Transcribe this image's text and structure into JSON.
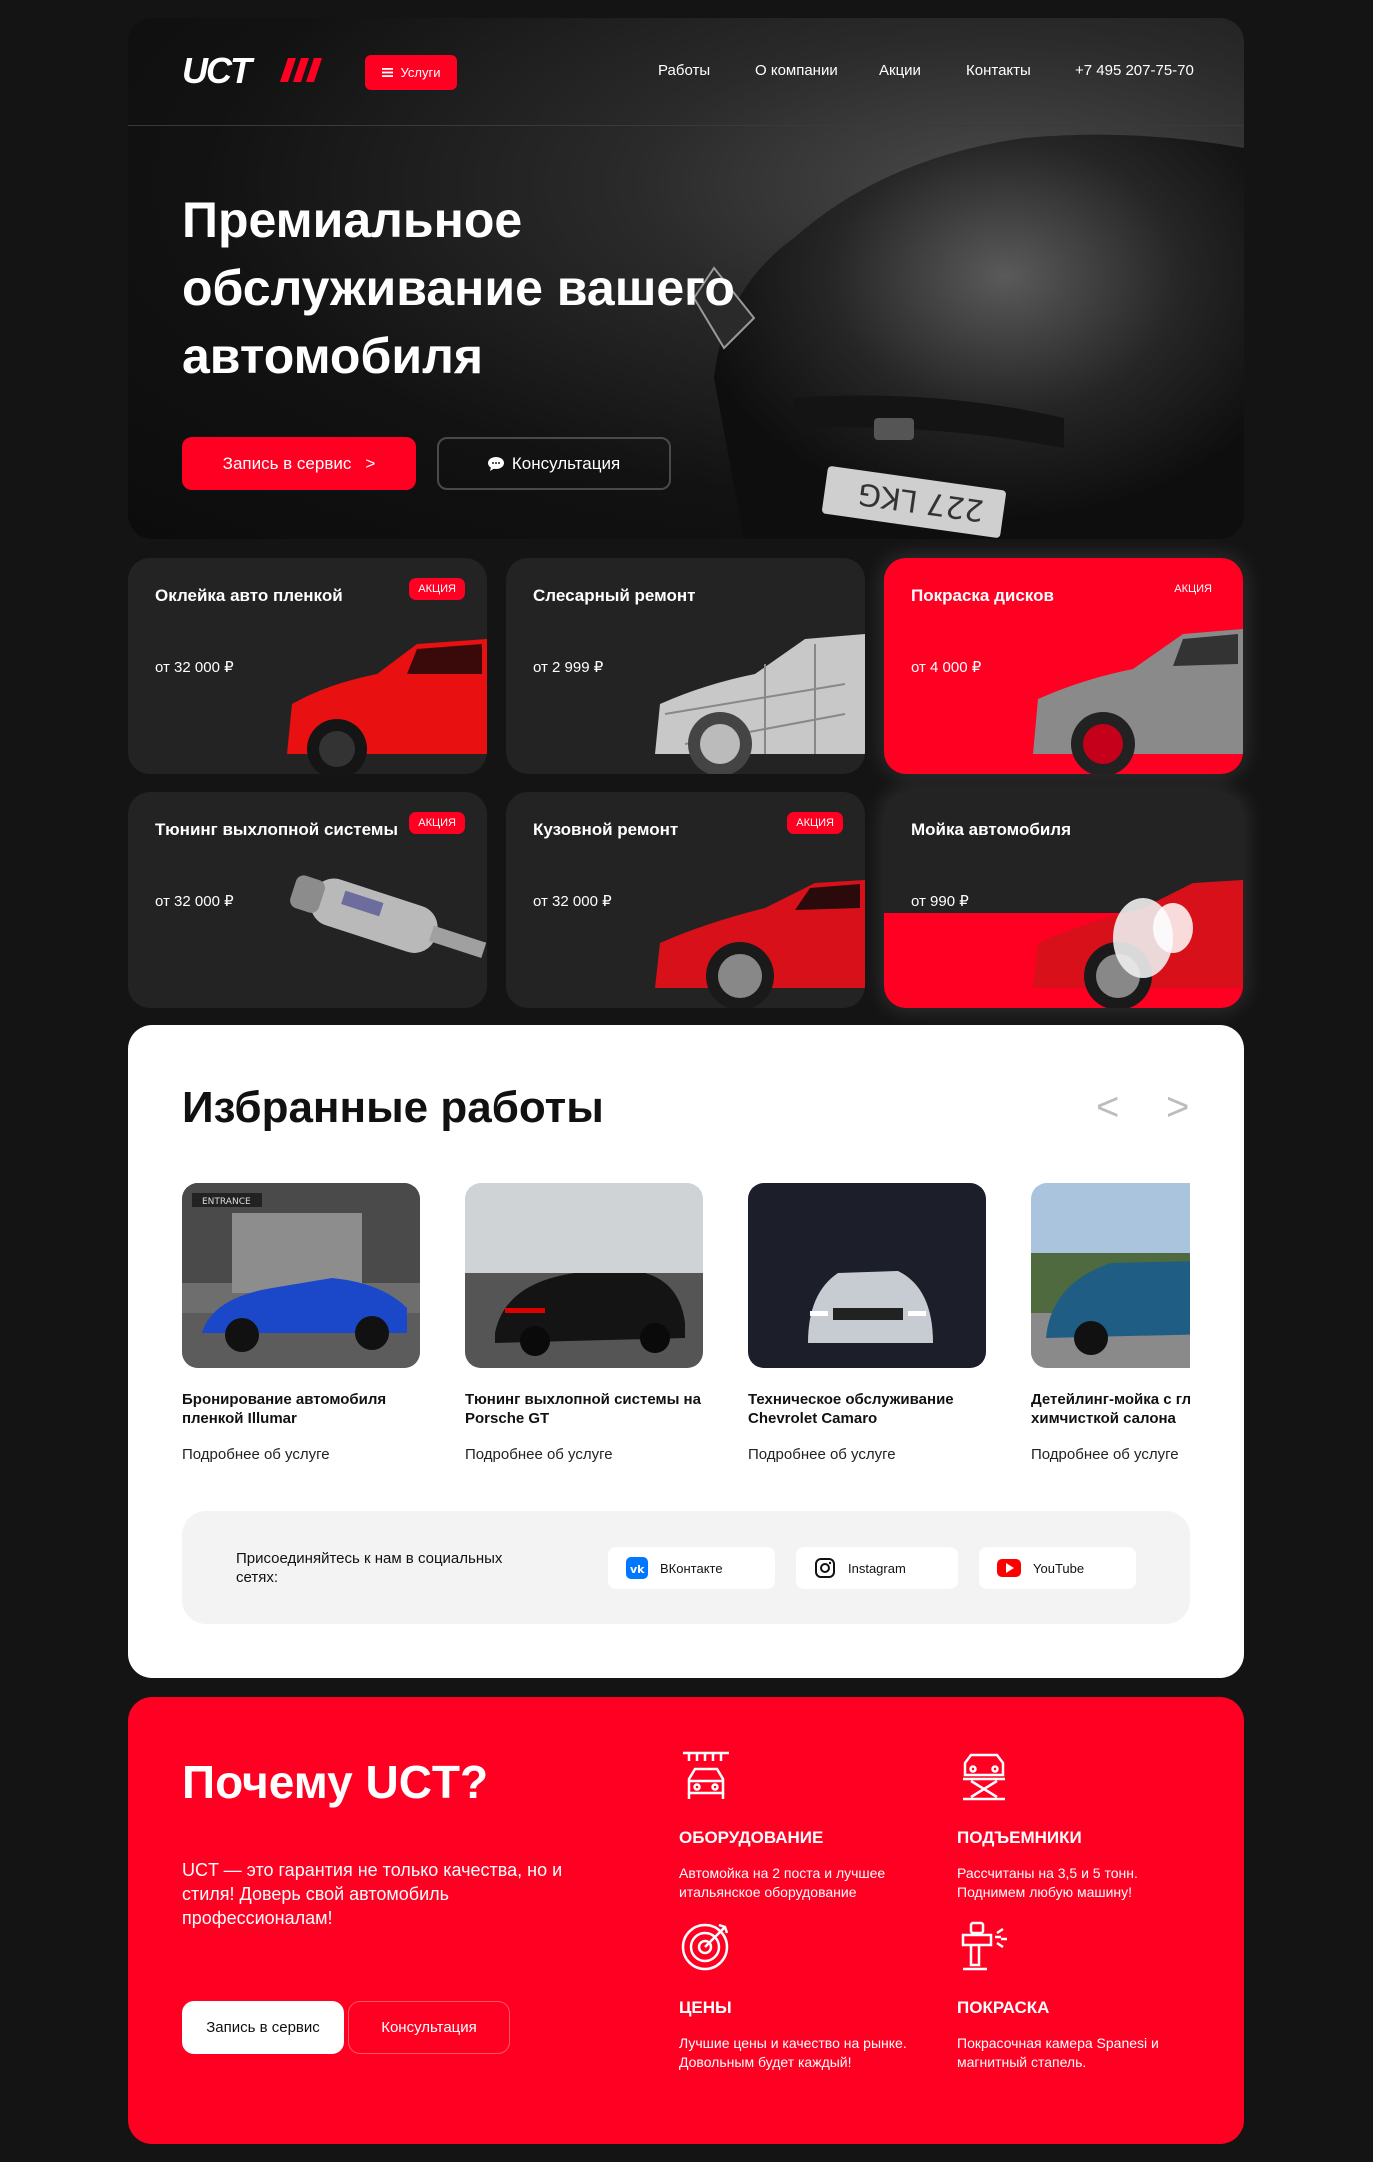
{
  "nav": {
    "logo": "UCT",
    "services_label": "Услуги",
    "links": [
      "Работы",
      "О компании",
      "Акции",
      "Контакты"
    ],
    "phone": "+7 495 207-75-70"
  },
  "hero": {
    "title": "Премиальное обслуживание вашего автомобиля",
    "primary_label": "Запись в сервис",
    "primary_arrow": ">",
    "secondary_label": "Консультация"
  },
  "services": [
    {
      "title": "Оклейка авто пленкой",
      "price": "от 32 000 ₽",
      "badge": "АКЦИЯ"
    },
    {
      "title": "Слесарный ремонт",
      "price": "от 2 999 ₽",
      "badge": ""
    },
    {
      "title": "Покраска дисков",
      "price": "от 4 000 ₽",
      "badge": "АКЦИЯ"
    },
    {
      "title": "Тюнинг выхлопной системы",
      "price": "от 32 000 ₽",
      "badge": "АКЦИЯ"
    },
    {
      "title": "Кузовной ремонт",
      "price": "от 32 000 ₽",
      "badge": "АКЦИЯ"
    },
    {
      "title": "Мойка автомобиля",
      "price": "от 990 ₽",
      "badge": ""
    }
  ],
  "works": {
    "title": "Избранные работы",
    "prev": "<",
    "next": ">",
    "items": [
      {
        "title": "Бронирование автомобиля пленкой Illumar",
        "link": "Подробнее об услуге",
        "sign": "ENTRANCE"
      },
      {
        "title": "Тюнинг выхлопной системы на Porsche GT",
        "link": "Подробнее об услуге"
      },
      {
        "title": "Техническое обслуживание Chevrolet Camaro",
        "link": "Подробнее об услуге"
      },
      {
        "title": "Детейлинг-мойка с глубокой химчисткой салона",
        "link": "Подробнее об услуге"
      }
    ],
    "social": {
      "text": "Присоединяйтесь к нам в социальных сетях:",
      "vk": "ВКонтакте",
      "instagram": "Instagram",
      "youtube": "YouTube"
    }
  },
  "why": {
    "title": "Почему UCT?",
    "text": "UCT — это гарантия не только качества, но и стиля! Доверь свой автомобиль профессионалам!",
    "primary_label": "Запись в сервис",
    "secondary_label": "Консультация",
    "features": [
      {
        "title": "ОБОРУДОВАНИЕ",
        "desc": "Автомойка на 2 поста и лучшее итальянское оборудование"
      },
      {
        "title": "ПОДЪЕМНИКИ",
        "desc": "Рассчитаны на 3,5 и 5 тонн. Поднимем любую машину!"
      },
      {
        "title": "ЦЕНЫ",
        "desc": "Лучшие цены и качество на рынке. Довольным будет каждый!"
      },
      {
        "title": "ПОКРАСКА",
        "desc": "Покрасочная камера Spanesi и магнитный стапель."
      }
    ]
  },
  "colors": {
    "accent": "#ff0022",
    "background": "#141414",
    "card": "#232323"
  }
}
